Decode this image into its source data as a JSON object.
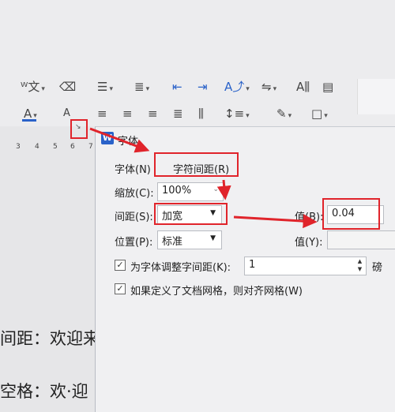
{
  "toolbar": {
    "row1_icons": [
      "phonetic-guide-icon",
      "eraser-icon",
      "bullet-list-icon",
      "numbered-list-icon",
      "decrease-indent-icon",
      "increase-indent-icon",
      "text-direction-icon",
      "line-break-icon",
      "paragraph-mark-icon",
      "table-borders-icon"
    ],
    "row2_icons": [
      "font-color-icon",
      "font-size-icon",
      "align-left-icon",
      "align-center-icon",
      "align-right-icon",
      "justify-icon",
      "distributed-icon",
      "line-spacing-icon",
      "shading-icon",
      "border-icon"
    ]
  },
  "ruler": {
    "numbers": [
      "3",
      "4",
      "5",
      "6",
      "7"
    ]
  },
  "dialog": {
    "app_badge": "W",
    "title": "字体",
    "tab_font": "字体(N)",
    "tab_spacing": "字符间距(R)",
    "scale_label": "缩放(C):",
    "scale_value": "100%",
    "spacing_label": "间距(S):",
    "spacing_value": "加宽",
    "value_b_label": "值(B):",
    "value_b": "0.04",
    "position_label": "位置(P):",
    "position_value": "标准",
    "value_y_label": "值(Y):",
    "kerning_label": "为字体调整字间距(K):",
    "kerning_value": "1",
    "kerning_unit": "磅",
    "grid_label": "如果定义了文档网格，则对齐网格(W)"
  },
  "document": {
    "line1": "间距：欢迎来",
    "line2": "空格：欢·迎"
  },
  "colors": {
    "annotation_red": "#e0242b",
    "accent_blue": "#2a62c9"
  }
}
